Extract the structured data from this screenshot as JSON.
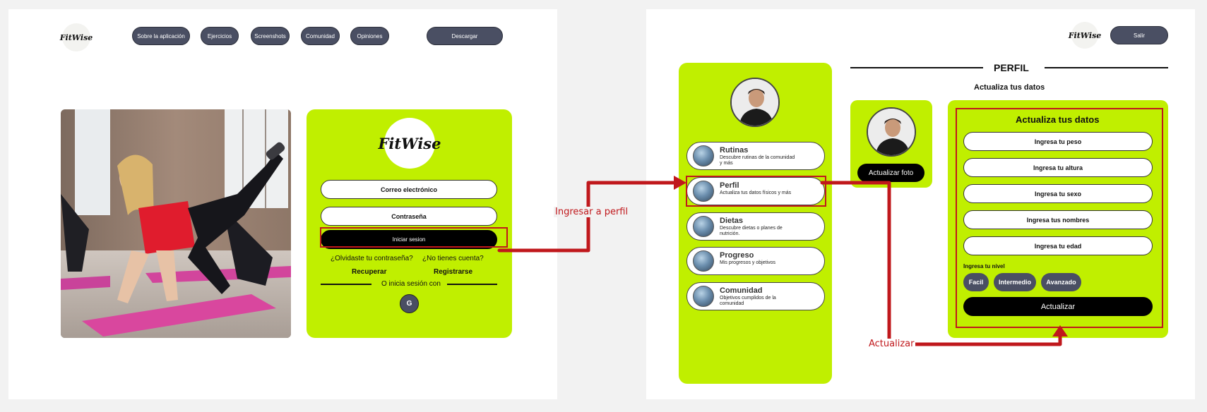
{
  "login_screen": {
    "logo": "FitWise",
    "nav": [
      "Sobre la aplicación",
      "Ejercicios",
      "Screenshots",
      "Comunidad",
      "Opiniones"
    ],
    "download": "Descargar",
    "card_logo": "FitWise",
    "email_placeholder": "Correo electrónico",
    "password_placeholder": "Contraseña",
    "login_button": "Iniciar sesion",
    "forgot": "¿Olvidaste tu contraseña?",
    "no_account": "¿No tienes cuenta?",
    "recover": "Recuperar",
    "register": "Registrarse",
    "divider": "O inicia sesión con",
    "google": "G"
  },
  "profile_screen": {
    "logo": "FitWise",
    "exit": "Salir",
    "section_title": "PERFIL",
    "subtitle": "Actualiza tus datos",
    "menu": [
      {
        "title": "Rutinas",
        "desc": "Descubre rutinas de la comunidad y más"
      },
      {
        "title": "Perfil",
        "desc": "Actualiza tus datos físicos y más"
      },
      {
        "title": "Dietas",
        "desc": "Descubre dietas o planes de nutrición."
      },
      {
        "title": "Progreso",
        "desc": "Mis progresos y objetivos"
      },
      {
        "title": "Comunidad",
        "desc": "Objetivos cumplidos de la comunidad"
      }
    ],
    "update_photo": "Actualizar foto",
    "form_title": "Actualiza tus datos",
    "fields": [
      "Ingresa tu peso",
      "Ingresa tu altura",
      "Ingresa tu sexo",
      "Ingresa tus nombres",
      "Ingresa tu edad"
    ],
    "level_label": "Ingresa tu nivel",
    "levels": [
      "Facil",
      "Intermedio",
      "Avanzado"
    ],
    "submit": "Actualizar"
  },
  "annotations": {
    "to_profile": "Ingresar a perfil",
    "update": "Actualizar"
  },
  "colors": {
    "lime": "#c0ef00",
    "nav_button": "#4a4f63",
    "highlight_red": "#c0181c"
  }
}
